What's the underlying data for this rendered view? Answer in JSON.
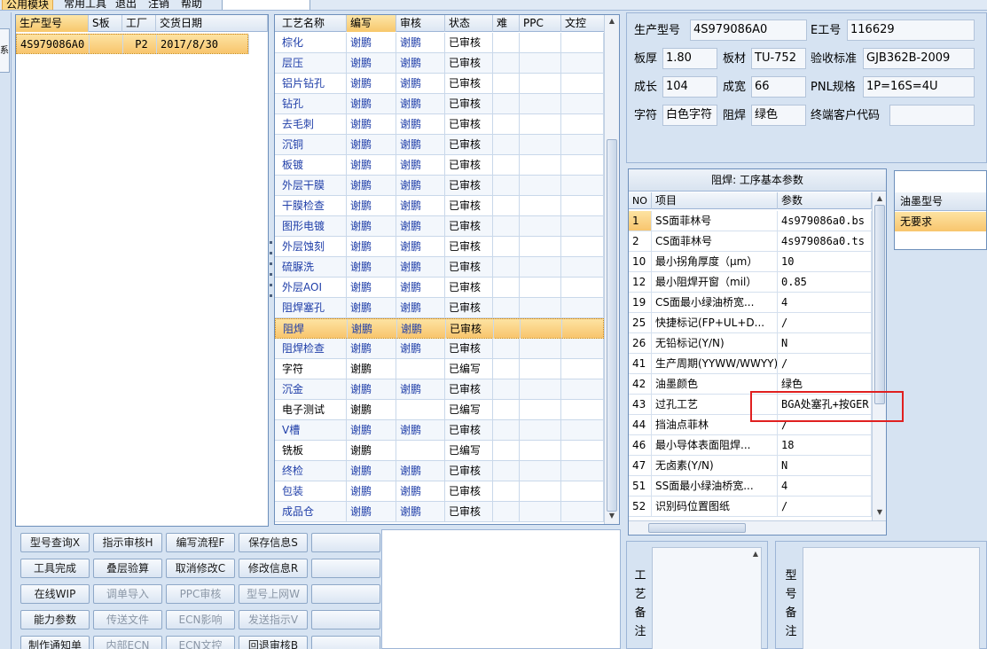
{
  "menu": {
    "items": [
      "公用模块",
      "常用工具",
      "退出",
      "注销",
      "帮助"
    ]
  },
  "left_tab": "系",
  "model_grid": {
    "headers": [
      "生产型号",
      "S板",
      "工厂",
      "交货日期"
    ],
    "rows": [
      {
        "model": "4S979086A0",
        "sboard": "",
        "factory": "P2",
        "date": "2017/8/30"
      }
    ]
  },
  "process_grid": {
    "headers": [
      "工艺名称",
      "编写",
      "审核",
      "状态",
      "难",
      "PPC",
      "文控"
    ],
    "rows": [
      {
        "name": "棕化",
        "writer": "谢鹏",
        "reviewer": "谢鹏",
        "status": "已审核"
      },
      {
        "name": "层压",
        "writer": "谢鹏",
        "reviewer": "谢鹏",
        "status": "已审核"
      },
      {
        "name": "铝片钻孔",
        "writer": "谢鹏",
        "reviewer": "谢鹏",
        "status": "已审核"
      },
      {
        "name": "钻孔",
        "writer": "谢鹏",
        "reviewer": "谢鹏",
        "status": "已审核"
      },
      {
        "name": "去毛刺",
        "writer": "谢鹏",
        "reviewer": "谢鹏",
        "status": "已审核"
      },
      {
        "name": "沉铜",
        "writer": "谢鹏",
        "reviewer": "谢鹏",
        "status": "已审核"
      },
      {
        "name": "板镀",
        "writer": "谢鹏",
        "reviewer": "谢鹏",
        "status": "已审核"
      },
      {
        "name": "外层干膜",
        "writer": "谢鹏",
        "reviewer": "谢鹏",
        "status": "已审核"
      },
      {
        "name": "干膜检查",
        "writer": "谢鹏",
        "reviewer": "谢鹏",
        "status": "已审核"
      },
      {
        "name": "图形电镀",
        "writer": "谢鹏",
        "reviewer": "谢鹏",
        "status": "已审核"
      },
      {
        "name": "外层蚀刻",
        "writer": "谢鹏",
        "reviewer": "谢鹏",
        "status": "已审核"
      },
      {
        "name": "硫脲洗",
        "writer": "谢鹏",
        "reviewer": "谢鹏",
        "status": "已审核"
      },
      {
        "name": "外层AOI",
        "writer": "谢鹏",
        "reviewer": "谢鹏",
        "status": "已审核"
      },
      {
        "name": "阻焊塞孔",
        "writer": "谢鹏",
        "reviewer": "谢鹏",
        "status": "已审核"
      },
      {
        "name": "阻焊",
        "writer": "谢鹏",
        "reviewer": "谢鹏",
        "status": "已审核"
      },
      {
        "name": "阻焊检查",
        "writer": "谢鹏",
        "reviewer": "谢鹏",
        "status": "已审核"
      },
      {
        "name": "字符",
        "writer": "谢鹏",
        "reviewer": "",
        "status": "已编写"
      },
      {
        "name": "沉金",
        "writer": "谢鹏",
        "reviewer": "谢鹏",
        "status": "已审核"
      },
      {
        "name": "电子测试",
        "writer": "谢鹏",
        "reviewer": "",
        "status": "已编写"
      },
      {
        "name": "V槽",
        "writer": "谢鹏",
        "reviewer": "谢鹏",
        "status": "已审核"
      },
      {
        "name": "铣板",
        "writer": "谢鹏",
        "reviewer": "",
        "status": "已编写"
      },
      {
        "name": "终检",
        "writer": "谢鹏",
        "reviewer": "谢鹏",
        "status": "已审核"
      },
      {
        "name": "包装",
        "writer": "谢鹏",
        "reviewer": "谢鹏",
        "status": "已审核"
      },
      {
        "name": "成品仓",
        "writer": "谢鹏",
        "reviewer": "谢鹏",
        "status": "已审核"
      }
    ]
  },
  "buttons": [
    [
      "型号查询X",
      "指示审核H",
      "编写流程F",
      "保存信息S",
      ""
    ],
    [
      "工具完成",
      "叠层验算",
      "取消修改C",
      "修改信息R",
      ""
    ],
    [
      "在线WIP",
      "调单导入",
      "PPC审核",
      "型号上网W",
      ""
    ],
    [
      "能力参数",
      "传送文件",
      "ECN影响",
      "发送指示V",
      ""
    ],
    [
      "制作通知单",
      "内部ECN",
      "ECN文控",
      "回退审核B",
      ""
    ]
  ],
  "info": {
    "model_label": "生产型号",
    "model_value": "4S979086A0",
    "eno_label": "E工号",
    "eno_value": "116629",
    "thickness_label": "板厚",
    "thickness_value": "1.80",
    "material_label": "板材",
    "material_value": "TU-752",
    "standard_label": "验收标准",
    "standard_value": "GJB362B-2009",
    "length_label": "成长",
    "length_value": "104",
    "width_label": "成宽",
    "width_value": "66",
    "pnl_label": "PNL规格",
    "pnl_value": "1P=16S=4U",
    "char_label": "字符",
    "char_value": "白色字符",
    "mask_label": "阻焊",
    "mask_value": "绿色",
    "customer_label": "终端客户代码",
    "customer_value": ""
  },
  "params": {
    "title": "阻焊: 工序基本参数",
    "headers": [
      "NO",
      "项目",
      "参数"
    ],
    "rows": [
      {
        "no": "1",
        "item": "SS面菲林号",
        "value": "4s979086a0.bs"
      },
      {
        "no": "2",
        "item": "CS面菲林号",
        "value": "4s979086a0.ts"
      },
      {
        "no": "10",
        "item": "最小拐角厚度（μm）",
        "value": "10"
      },
      {
        "no": "12",
        "item": "最小阻焊开窗（mil）",
        "value": "0.85"
      },
      {
        "no": "19",
        "item": "CS面最小绿油桥宽...",
        "value": "4"
      },
      {
        "no": "25",
        "item": "快捷标记(FP+UL+D...",
        "value": "/"
      },
      {
        "no": "26",
        "item": "无铅标记(Y/N)",
        "value": "N"
      },
      {
        "no": "41",
        "item": "生产周期(YYWW/WWYY)",
        "value": "/"
      },
      {
        "no": "42",
        "item": "油墨颜色",
        "value": "绿色"
      },
      {
        "no": "43",
        "item": "过孔工艺",
        "value": "BGA处塞孔+按GER"
      },
      {
        "no": "44",
        "item": "挡油点菲林",
        "value": "/"
      },
      {
        "no": "46",
        "item": "最小导体表面阻焊...",
        "value": "18"
      },
      {
        "no": "47",
        "item": "无卤素(Y/N)",
        "value": "N"
      },
      {
        "no": "51",
        "item": "SS面最小绿油桥宽...",
        "value": "4"
      },
      {
        "no": "52",
        "item": "识别码位置图纸",
        "value": "/"
      }
    ]
  },
  "ink": {
    "header": "油墨型号",
    "value": "无要求"
  },
  "remarks": {
    "process_label": "工艺备注",
    "model_label": "型号备注"
  }
}
